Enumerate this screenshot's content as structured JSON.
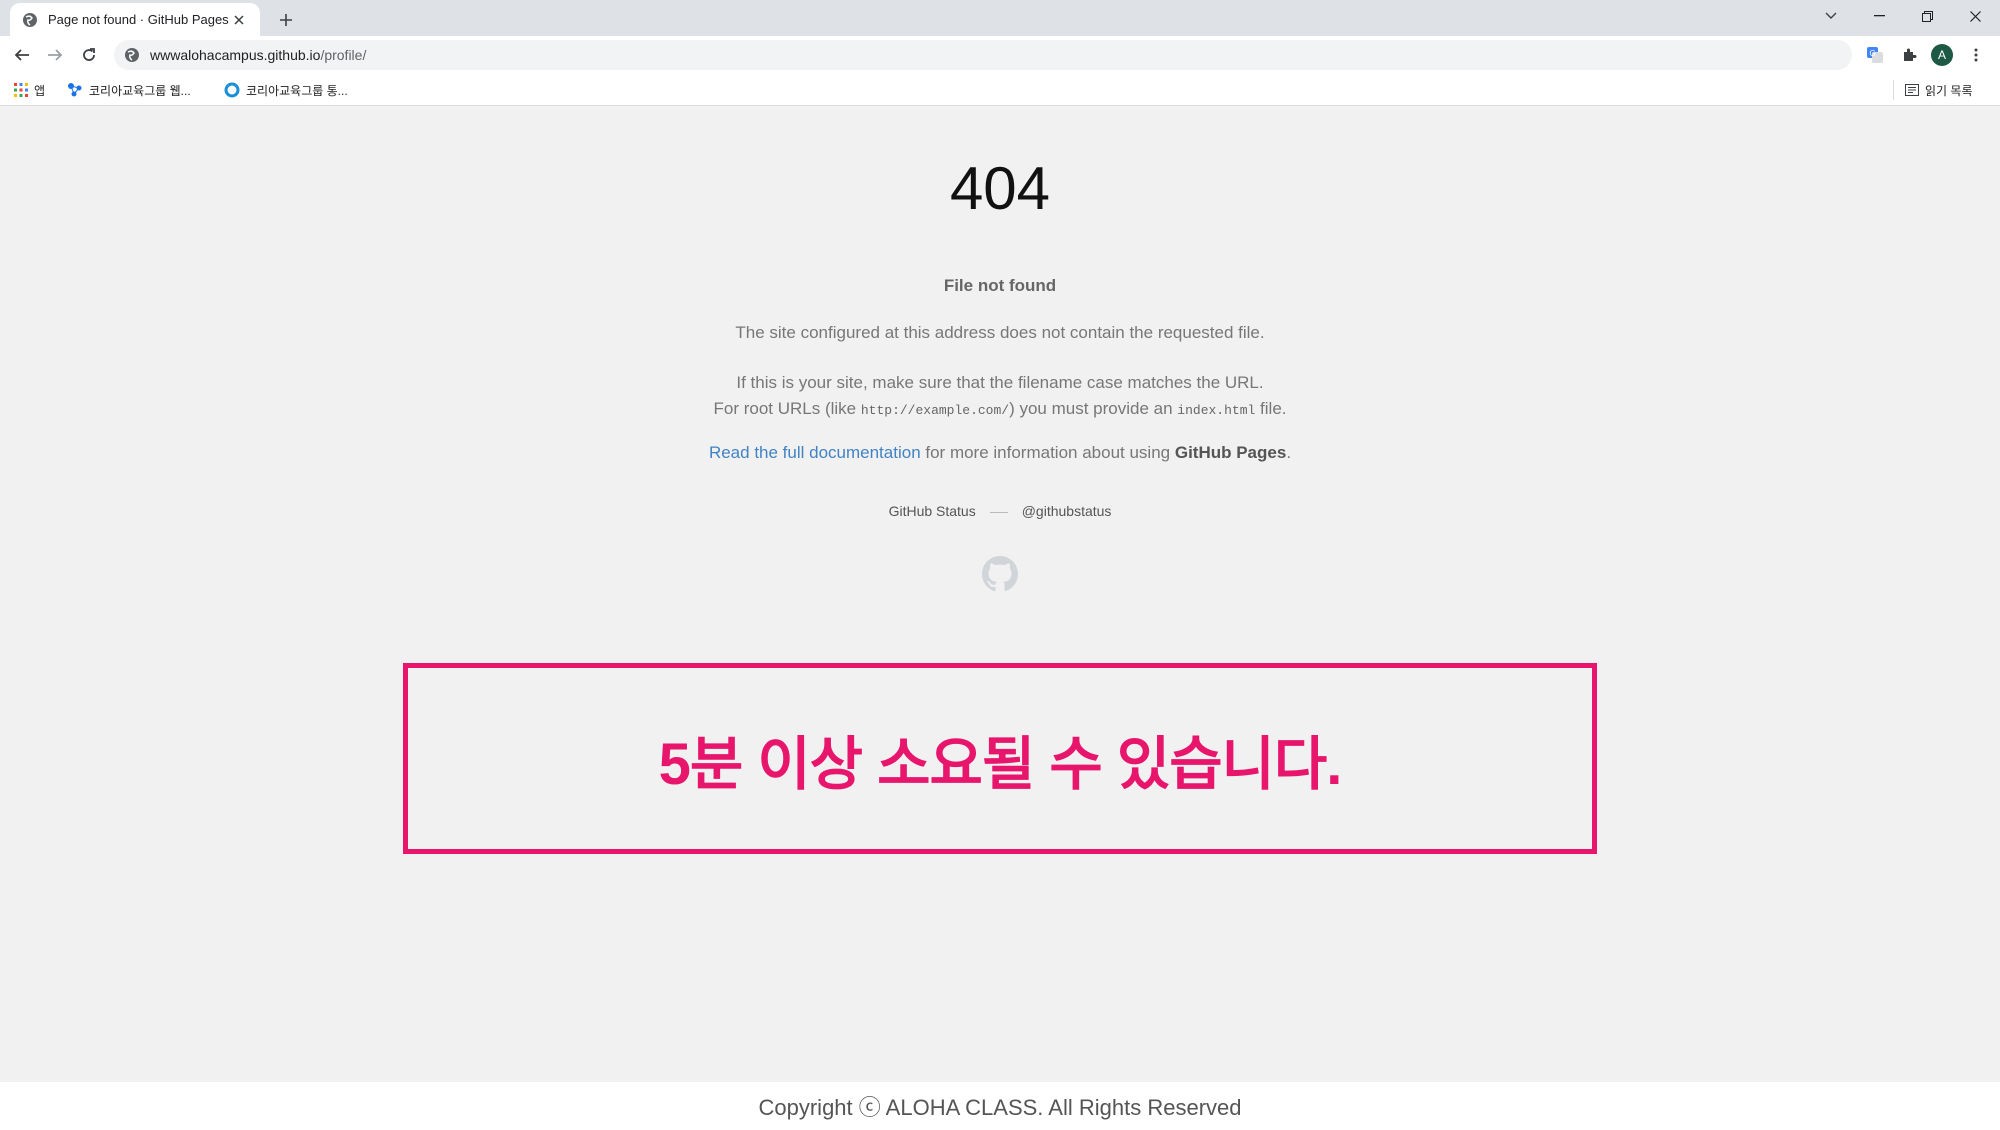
{
  "browser": {
    "tab_title": "Page not found · GitHub Pages",
    "url_host": "wwwalohacampus.github.io",
    "url_path": "/profile/",
    "avatar_letter": "A",
    "bookmarks": [
      "앱",
      "코리아교육그룹 웹...",
      "코리아교육그룹 통..."
    ],
    "reading_list": "읽기 목록"
  },
  "page": {
    "heading": "404",
    "subheading": "File not found",
    "para1": "The site configured at this address does not contain the requested file.",
    "para2_line1": "If this is your site, make sure that the filename case matches the URL.",
    "para2_pre": "For root URLs (like ",
    "para2_code1": "http://example.com/",
    "para2_mid": ") you must provide an ",
    "para2_code2": "index.html",
    "para2_post": " file.",
    "doc_link": "Read the full documentation",
    "doc_mid": " for more information about using ",
    "doc_strong": "GitHub Pages",
    "doc_end": ".",
    "status_link": "GitHub Status",
    "twitter_link": "@githubstatus"
  },
  "callout": {
    "text": "5분 이상 소요될 수 있습니다.",
    "color": "#e8156c"
  },
  "footer": {
    "copyright": "Copyright ⓒ ALOHA CLASS. All Rights Reserved"
  }
}
